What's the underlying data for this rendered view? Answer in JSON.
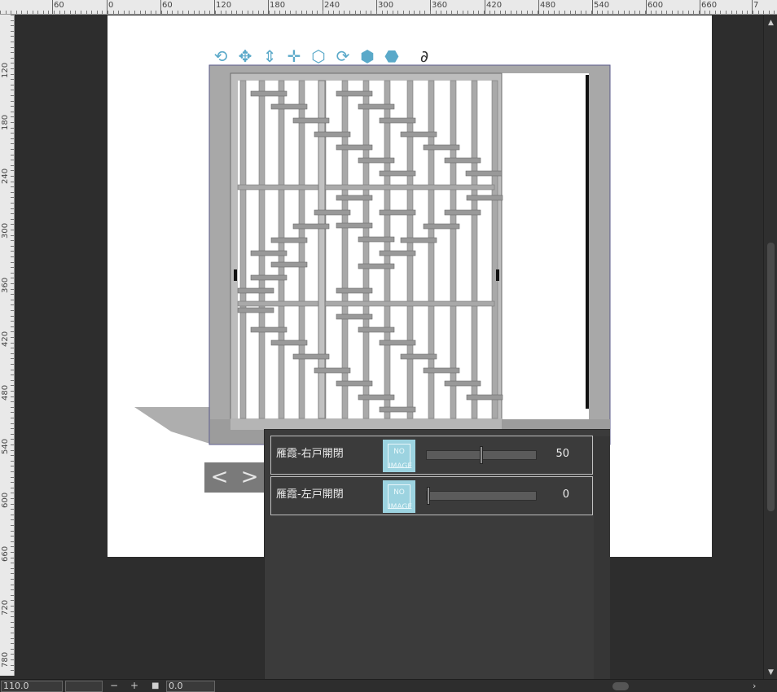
{
  "ruler": {
    "top_labels": [
      "60",
      "0",
      "60",
      "120",
      "180",
      "240",
      "300",
      "360",
      "420",
      "480",
      "540",
      "600",
      "660",
      "7"
    ],
    "left_labels": [
      "120",
      "180",
      "240",
      "300",
      "360",
      "420",
      "480",
      "540",
      "600",
      "660",
      "720",
      "780"
    ]
  },
  "toolbar": {
    "icons": [
      "camera-rotate-icon",
      "camera-pan-icon",
      "camera-dolly-icon",
      "move-object-icon",
      "rotate-object-icon",
      "rotate-y-object-icon",
      "rotate-x-object-icon",
      "scale-object-icon",
      "snap-magnet-icon"
    ]
  },
  "nav": {
    "prev": "<",
    "next": ">"
  },
  "object_list": {
    "rows": [
      {
        "label": "雁霞-右戸開閉",
        "thumb": "NO IMAGE",
        "value": "50",
        "level": 0.5
      },
      {
        "label": "雁霞-左戸開閉",
        "thumb": "NO IMAGE",
        "value": "0",
        "level": 0
      }
    ]
  },
  "status": {
    "zoom": "110.0",
    "minus": "−",
    "plus": "+",
    "angle": "0.0"
  },
  "colors": {
    "frame": "#a8a8a8",
    "frame_dark": "#7d7d7d",
    "thumb_bg": "#9cd3e0",
    "panel_bg": "#3b3b3b"
  }
}
